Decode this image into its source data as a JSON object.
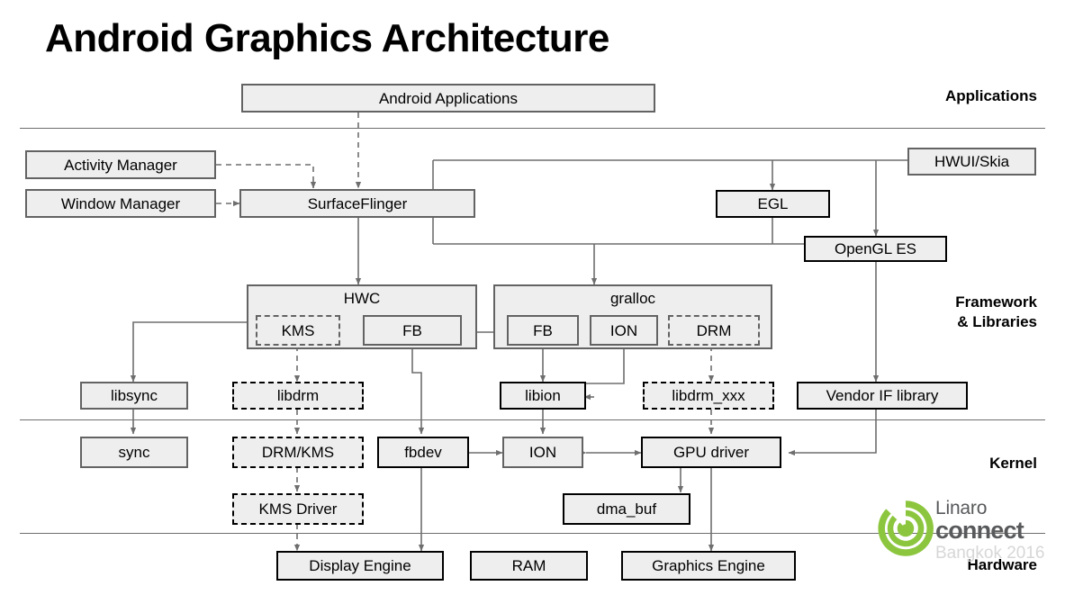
{
  "title": "Android Graphics Architecture",
  "sections": [
    {
      "name": "applications",
      "label": "Applications"
    },
    {
      "name": "framework",
      "label": "Framework\n& Libraries"
    },
    {
      "name": "kernel",
      "label": "Kernel"
    },
    {
      "name": "hardware",
      "label": "Hardware"
    }
  ],
  "colors": {
    "box_fill": "#eeeeee",
    "box_border_gray": "#636363",
    "box_border_black": "#000000",
    "divider": "#6e6e6e",
    "wire": "#6e6e6e",
    "logo_green": "#8cc63e",
    "logo_gray": "#58595b",
    "logo_city": "#d7d7d7"
  },
  "nodes": {
    "android_applications": "Android Applications",
    "activity_manager": "Activity Manager",
    "window_manager": "Window Manager",
    "surfaceflinger": "SurfaceFlinger",
    "hwui_skia": "HWUI/Skia",
    "egl": "EGL",
    "opengl_es": "OpenGL ES",
    "hwc": "HWC",
    "hwc_kms": "KMS",
    "hwc_fb": "FB",
    "gralloc": "gralloc",
    "gralloc_fb": "FB",
    "gralloc_ion": "ION",
    "gralloc_drm": "DRM",
    "libsync": "libsync",
    "libdrm": "libdrm",
    "libion": "libion",
    "libdrm_xxx": "libdrm_xxx",
    "vendor_if_library": "Vendor IF library",
    "sync": "sync",
    "drm_kms": "DRM/KMS",
    "fbdev": "fbdev",
    "ion": "ION",
    "gpu_driver": "GPU driver",
    "kms_driver": "KMS Driver",
    "dma_buf": "dma_buf",
    "display_engine": "Display Engine",
    "ram": "RAM",
    "graphics_engine": "Graphics Engine"
  },
  "logo": {
    "brand": "Linaro",
    "event": "connect",
    "city": "Bangkok 2016"
  }
}
